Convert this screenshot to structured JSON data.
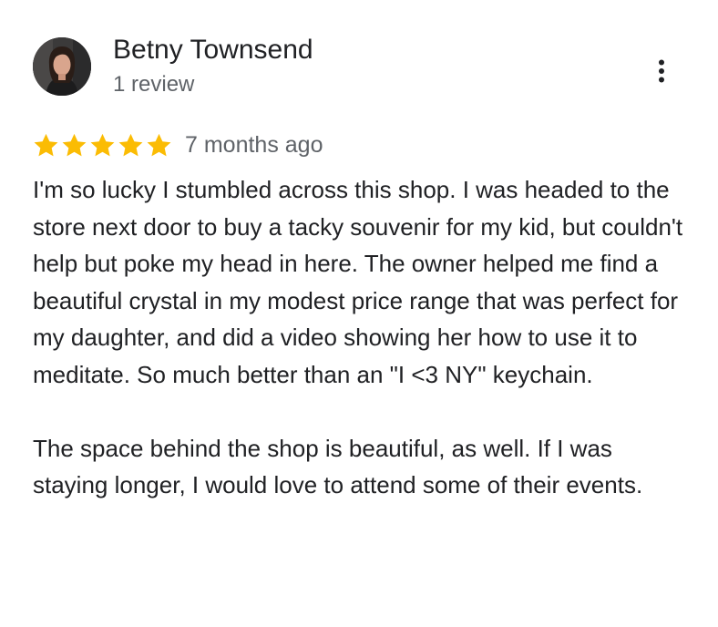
{
  "reviewer": {
    "name": "Betny Townsend",
    "review_count": "1 review",
    "avatar_icon": "avatar-photo"
  },
  "menu": {
    "icon": "more-vert-icon"
  },
  "rating": {
    "stars": 5,
    "max_stars": 5,
    "star_color": "#fbbc04",
    "date": "7 months ago"
  },
  "review": {
    "paragraphs": [
      "I'm so lucky I stumbled across this shop. I was headed to the store next door to buy a tacky souvenir for my kid, but couldn't help but poke my head in here. The owner helped me find a beautiful crystal in my modest price range that was perfect for my daughter, and did a video showing her how to use it to meditate. So much better than an \"I <3 NY\" keychain.",
      "The space behind the shop is beautiful, as well. If I was staying longer, I would love to attend some of their events."
    ]
  },
  "colors": {
    "text_primary": "#202124",
    "text_secondary": "#5f6368",
    "star": "#fbbc04"
  }
}
